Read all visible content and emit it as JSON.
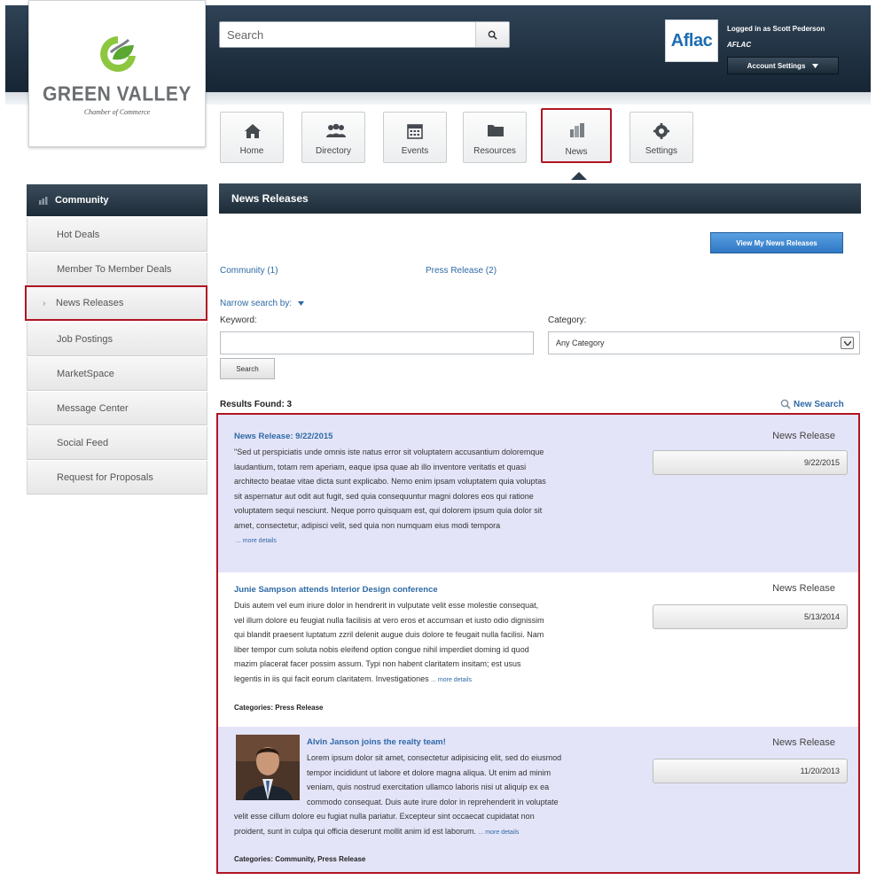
{
  "header": {
    "search_placeholder": "Search",
    "account": {
      "logo_text": "Aflac",
      "logged_in": "Logged in as Scott Pederson",
      "company": "AFLAC",
      "settings_label": "Account Settings"
    }
  },
  "logo": {
    "name": "GREEN VALLEY",
    "tagline": "Chamber of Commerce"
  },
  "nav": {
    "items": [
      {
        "label": "Home",
        "icon": "home-icon"
      },
      {
        "label": "Directory",
        "icon": "people-icon"
      },
      {
        "label": "Events",
        "icon": "calendar-icon"
      },
      {
        "label": "Resources",
        "icon": "folder-icon"
      },
      {
        "label": "News",
        "icon": "news-icon",
        "active": true
      },
      {
        "label": "Settings",
        "icon": "gear-icon"
      }
    ]
  },
  "sidebar": {
    "heading": "Community",
    "items": [
      {
        "label": "Hot Deals"
      },
      {
        "label": "Member To Member Deals"
      },
      {
        "label": "News Releases",
        "active": true
      },
      {
        "label": "Job Postings"
      },
      {
        "label": "MarketSpace"
      },
      {
        "label": "Message Center"
      },
      {
        "label": "Social Feed"
      },
      {
        "label": "Request for Proposals"
      }
    ]
  },
  "content": {
    "title": "News Releases",
    "view_button": "View My News Releases",
    "facets": [
      "Community (1)",
      "Press Release (2)"
    ],
    "narrow_label": "Narrow search by:",
    "keyword_label": "Keyword:",
    "category_label": "Category:",
    "category_value": "Any Category",
    "search_button": "Search",
    "results_label": "Results Found: 3",
    "new_search": "New Search"
  },
  "results": [
    {
      "title": "News Release: 9/22/2015",
      "type": "News Release",
      "date": "9/22/2015",
      "lines": [
        "\"Sed ut perspiciatis unde omnis iste natus error sit voluptatem accusantium doloremque",
        "laudantium, totam rem aperiam, eaque ipsa quae ab illo inventore veritatis et quasi",
        "architecto beatae vitae dicta sunt explicabo. Nemo enim ipsam voluptatem quia voluptas",
        "sit aspernatur aut odit aut fugit, sed quia consequuntur magni dolores eos qui ratione",
        "voluptatem sequi nesciunt. Neque porro quisquam est, qui dolorem ipsum quia dolor sit",
        "amet, consectetur, adipisci velit, sed quia non numquam eius modi tempora"
      ],
      "more": "... more details"
    },
    {
      "title": "Junie Sampson attends Interior Design conference",
      "type": "News Release",
      "date": "5/13/2014",
      "lines": [
        "Duis autem vel eum iriure dolor in hendrerit in vulputate velit esse molestie consequat,",
        "vel illum dolore eu feugiat nulla facilisis at vero eros et accumsan et iusto odio dignissim",
        "qui blandit praesent luptatum zzril delenit augue duis dolore te feugait nulla facilisi. Nam",
        "liber tempor cum soluta nobis eleifend option congue nihil imperdiet doming id quod",
        "mazim placerat facer possim assum. Typi non habent claritatem insitam; est usus",
        "legentis in iis qui facit eorum claritatem. Investigationes"
      ],
      "more": "... more details",
      "categories": "Categories: Press Release"
    },
    {
      "title": "Alvin Janson joins the realty team!",
      "type": "News Release",
      "date": "11/20/2013",
      "lines_indented": [
        "Lorem ipsum dolor sit amet, consectetur adipisicing elit, sed do eiusmod",
        "tempor incididunt ut labore et dolore magna aliqua. Ut enim ad minim",
        "veniam, quis nostrud exercitation ullamco laboris nisi ut aliquip ex ea",
        "commodo consequat. Duis aute irure dolor in reprehenderit in voluptate"
      ],
      "lines": [
        "velit esse cillum dolore eu fugiat nulla pariatur. Excepteur sint occaecat cupidatat non",
        "proident, sunt in culpa qui officia deserunt mollit anim id est laborum."
      ],
      "more": "... more details",
      "categories": "Categories: Community, Press Release"
    }
  ],
  "colors": {
    "accent": "#b01523",
    "header_dark": "#1f3040",
    "link": "#2e6aa5",
    "row_tint": "#e4e4f9",
    "primary_button": "#2f78c4"
  }
}
